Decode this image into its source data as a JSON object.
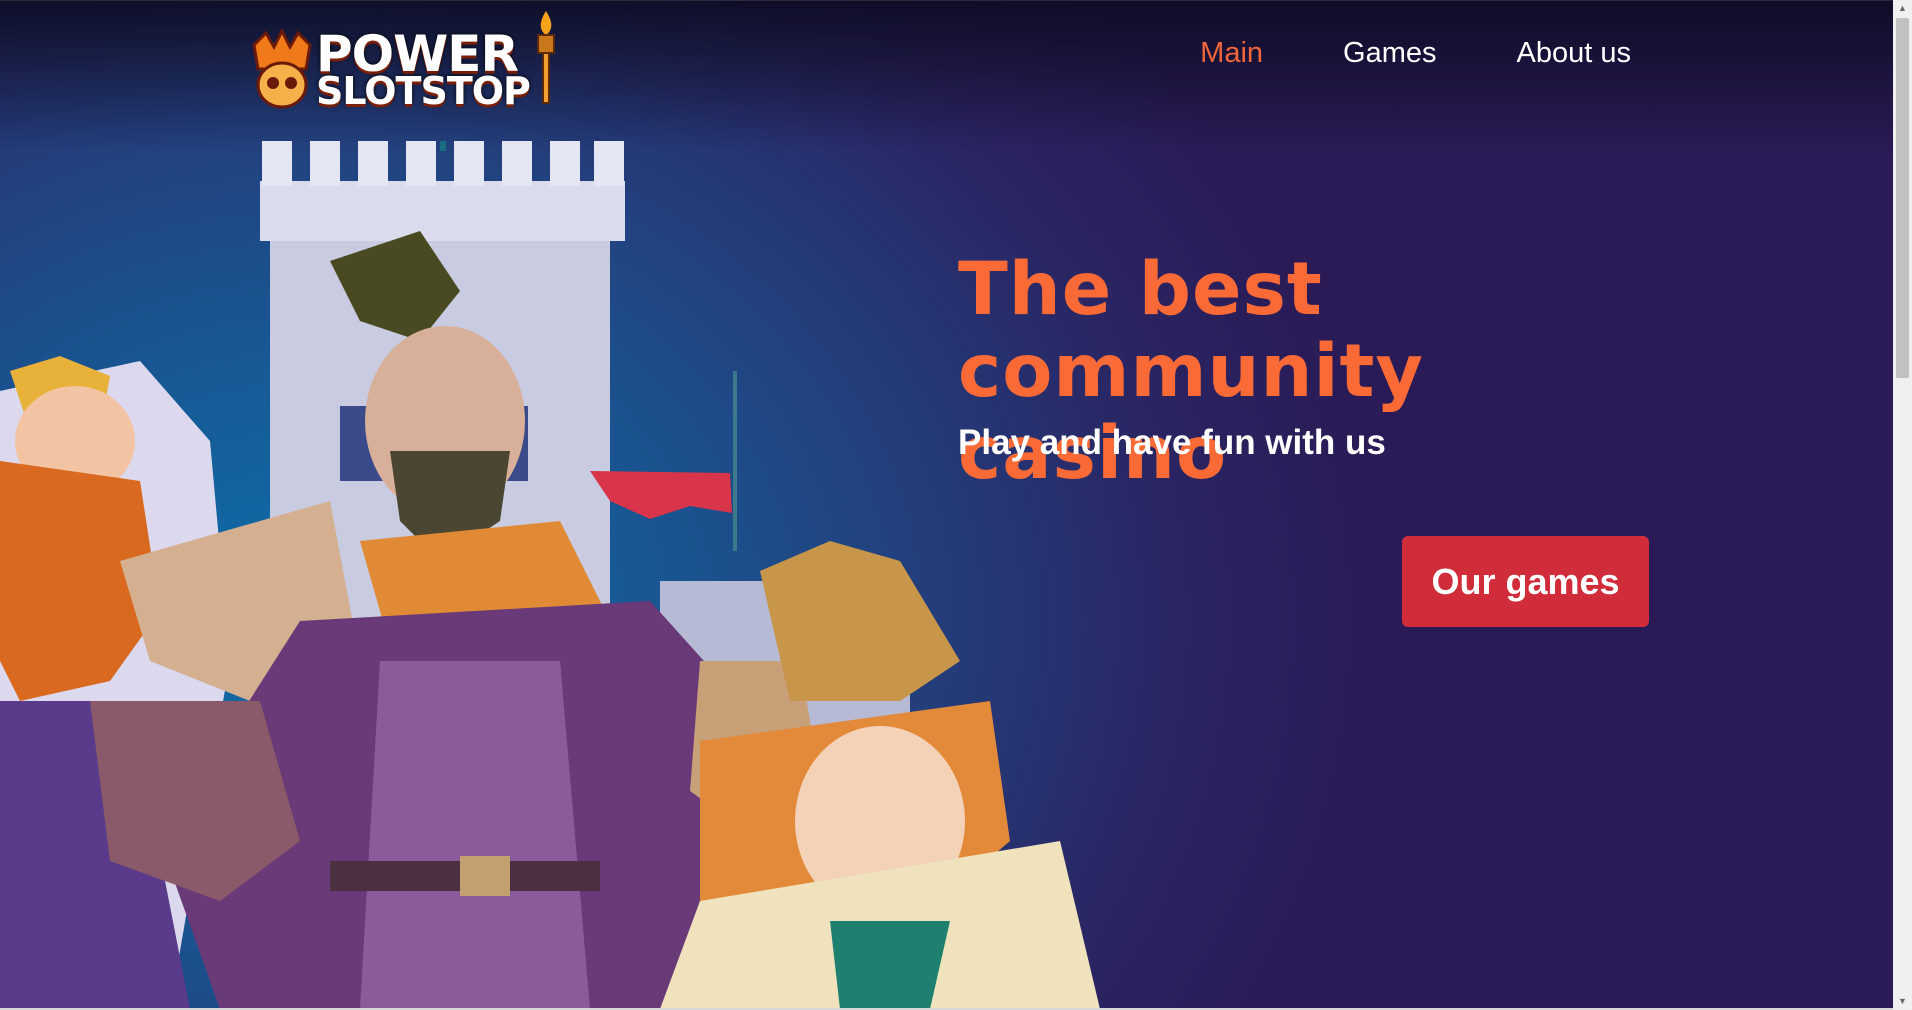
{
  "logo": {
    "line1": "POWER",
    "line2": "SLOTSTOP"
  },
  "nav": {
    "items": [
      {
        "label": "Main",
        "active": true
      },
      {
        "label": "Games",
        "active": false
      },
      {
        "label": "About us",
        "active": false
      }
    ]
  },
  "hero": {
    "title": "The best community casino",
    "subtitle": "Play and have fun with us",
    "cta_label": "Our games"
  },
  "colors": {
    "accent": "#fa6a36",
    "cta": "#d02c3a",
    "bg_dark": "#2a1a55",
    "bg_blue": "#0f6fa8"
  }
}
